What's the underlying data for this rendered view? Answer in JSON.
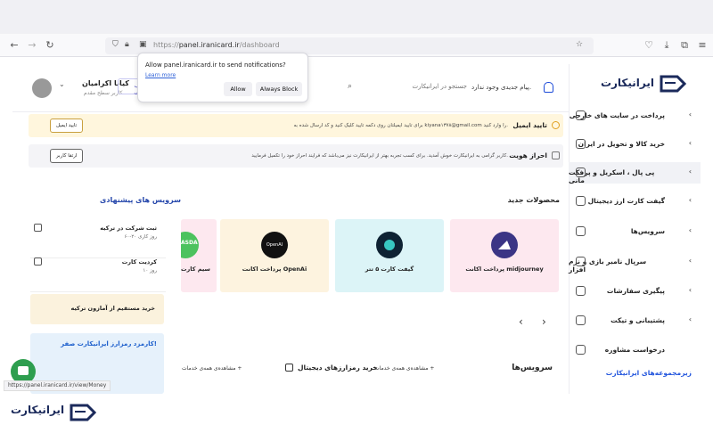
{
  "browser": {
    "url_host": "panel.iranicard.ir",
    "url_path": "/dashboard",
    "url_scheme": "https://",
    "status_url": "https://panel.iranicard.ir/view/Money"
  },
  "popup": {
    "message": "Allow panel.iranicard.ir to send notifications?",
    "learn_more": "Learn more",
    "allow": "Allow",
    "block": "Always Block"
  },
  "header": {
    "user_name": "کیانا اکرامیان",
    "user_sub": "کاربر سطح مقدم",
    "search_placeholder": "جستجو در ایرانیکارت",
    "message": "پیام جدیدی وجود ندارد.",
    "partial_chip": "حساب حقیقی"
  },
  "banners": {
    "email": {
      "title": "تایید ایمیل",
      "text": "برای تایید ایمیلتان روی دکمه تایید کلیک کنید و کد ارسال شده به kiyana۱۳۷۸@gmail.com را وارد کنید.",
      "button": "تایید ایمیل"
    },
    "identity": {
      "title": "احراز هویت",
      "text": "کاربر گرامی به ایرانیکارت خوش آمدید. برای کسب تجربه بهتر از ایرانیکارت نیز می‌باشد که فرایند احراز خود را تکمیل فرمایید.",
      "button": "ارتقا کاربر"
    }
  },
  "sections": {
    "products": "محصولات جدید",
    "suggested": "سرویس های پیشنهادی",
    "services": "سرویس‌ها",
    "digital": "خرید رمزارزهای دیجیتال",
    "all_services_1": "مشاهده‌ی همه‌ی خدمات +",
    "all_services_2": "مشاهده‌ی همه‌ی خدمات +"
  },
  "products": [
    {
      "label": "پرداخت اکانت midjourney"
    },
    {
      "label": "گیفت کارت ۵ تتر"
    },
    {
      "label": "پرداخت اکانت OpenAi"
    },
    {
      "label": "سیم کارت",
      "badge": "ASDA"
    }
  ],
  "openai_logo_text": "OpenAI",
  "suggested": [
    {
      "title": "ثبت شرکت در ترکیه",
      "sub": "۶۰-۲۰ روز کاری"
    },
    {
      "title": "کردیت کارت",
      "sub": "۱۰ روز"
    }
  ],
  "promo": "خرید مستقیم از آمازون ترکیه",
  "promo_banner": "کارمزد رمزارز ایرانیکارت صفر!",
  "sidebar": {
    "logo_text": "ایرانیکارت",
    "items": [
      {
        "label": "پرداخت در سایت های خارجی"
      },
      {
        "label": "خرید کالا و تحویل در ایران"
      },
      {
        "label": "پی پال ، اسکریل و پرفکت مانی"
      },
      {
        "label": "گیفت کارت ارز دیجیتال"
      },
      {
        "label": "سرویس‌ها"
      },
      {
        "label": "سرپال نامبر بازی و نرم افزار"
      },
      {
        "label": "پیگیری سفارشات"
      },
      {
        "label": "پشتیبانی و تیکت"
      },
      {
        "label": "درخواست مشاوره"
      }
    ],
    "link": "زیرمجموعه‌های ایرانیکارت"
  },
  "watermark": "ایرانیکارت",
  "colors": {
    "brand_navy": "#1b2a5b",
    "link_blue": "#2255dd",
    "email_banner": "#fff6dd",
    "chat_green": "#2e9e4f"
  }
}
